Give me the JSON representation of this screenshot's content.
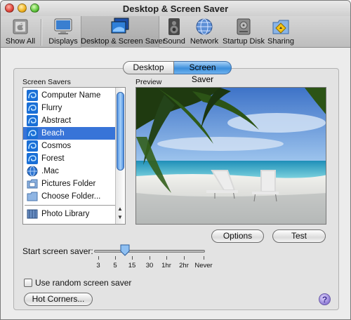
{
  "window": {
    "title": "Desktop & Screen Saver"
  },
  "toolbar": {
    "show_all": "Show All",
    "displays": "Displays",
    "desktop_screen_saver": "Desktop & Screen Saver",
    "sound": "Sound",
    "network": "Network",
    "startup_disk": "Startup Disk",
    "sharing": "Sharing"
  },
  "tabs": {
    "desktop": "Desktop",
    "screen_saver": "Screen Saver",
    "active": "Screen Saver"
  },
  "screen_savers": {
    "label": "Screen Savers",
    "items": [
      "Computer Name",
      "Flurry",
      "Abstract",
      "Beach",
      "Cosmos",
      "Forest",
      ".Mac",
      "Pictures Folder",
      "Choose Folder...",
      "Photo Library"
    ],
    "selected": "Beach"
  },
  "preview": {
    "label": "Preview"
  },
  "buttons": {
    "options": "Options",
    "test": "Test",
    "hot_corners": "Hot Corners..."
  },
  "start_screen_saver": {
    "label": "Start screen saver:",
    "ticks": [
      "3",
      "5",
      "15",
      "30",
      "1hr",
      "2hr",
      "Never"
    ],
    "selected": "15"
  },
  "random_checkbox": {
    "label": "Use random screen saver",
    "checked": false
  },
  "help": {
    "glyph": "?"
  },
  "colors": {
    "selection": "#3874d8",
    "tab_active": "#3d8fdb"
  }
}
